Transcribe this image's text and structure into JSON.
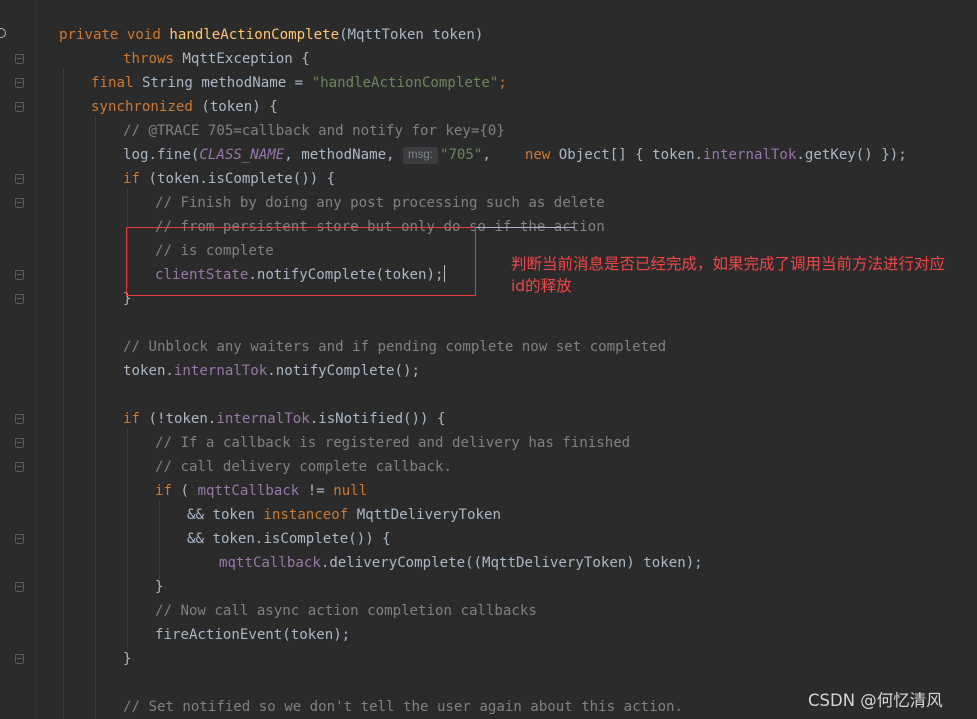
{
  "code_lines": {
    "l1": {
      "kw1": "private",
      "kw2": "void",
      "fn": "handleActionComplete",
      "rest": "(MqttToken token)"
    },
    "l2": {
      "kw": "throws",
      "rest": "MqttException {"
    },
    "l3": {
      "kw": "final",
      "mid": "String methodName = ",
      "str": "\"handleActionComplete\"",
      "end": ";"
    },
    "l4": {
      "kw": "synchronized",
      "rest": "(token) {"
    },
    "l5": {
      "cm": "// @TRACE 705=callback and notify for key={0}"
    },
    "l6": {
      "a": "log.fine(",
      "const": "CLASS_NAME",
      "b": ", methodName, ",
      "hint": "msg:",
      "str": "\"705\"",
      "kw": "new",
      "c": "Object[] { token.",
      "fld": "internalTok",
      "d": ".getKey() });"
    },
    "l7": {
      "kw": "if",
      "rest": "(token.isComplete()) {"
    },
    "l8": {
      "cm": "// Finish by doing any post processing such as delete"
    },
    "l9": {
      "cm": "// from persistent store but only do so if the action"
    },
    "l10": {
      "cm": "// is complete"
    },
    "l11": {
      "fld": "clientState",
      "rest": ".notifyComplete(token);"
    },
    "l12": {
      "rest": "}"
    },
    "l13": {
      "cm": "// Unblock any waiters and if pending complete now set completed"
    },
    "l14": {
      "a": "token.",
      "fld": "internalTok",
      "b": ".notifyComplete();"
    },
    "l15": {
      "kw": "if",
      "a": "(!token.",
      "fld": "internalTok",
      "b": ".isNotified()) {"
    },
    "l16": {
      "cm": "// If a callback is registered and delivery has finished"
    },
    "l17": {
      "cm": "// call delivery complete callback."
    },
    "l18": {
      "kw1": "if",
      "a": "( ",
      "fld": "mqttCallback",
      "b": " != ",
      "kw2": "null"
    },
    "l19": {
      "a": "&& token ",
      "kw": "instanceof",
      "b": "MqttDeliveryToken"
    },
    "l20": {
      "a": "&& token.isComplete()) {"
    },
    "l21": {
      "fld": "mqttCallback",
      "rest": ".deliveryComplete((MqttDeliveryToken) token);"
    },
    "l22": {
      "rest": "}"
    },
    "l23": {
      "cm": "// Now call async action completion callbacks"
    },
    "l24": {
      "rest": "fireActionEvent(token);"
    },
    "l25": {
      "rest": "}"
    },
    "l26": {
      "cm": "// Set notified so we don't tell the user again about this action."
    }
  },
  "annotation": {
    "text": "判断当前消息是否已经完成，如果完成了调用当前方法进行对应\nid的释放",
    "color": "#f24545"
  },
  "watermark": "CSDN @何忆清风",
  "colors": {
    "background": "#2b2b2b",
    "keyword": "#cc7832",
    "method": "#ffc66d",
    "string": "#6a8759",
    "comment": "#808080",
    "field": "#9876aa",
    "default": "#a9b7c6"
  }
}
